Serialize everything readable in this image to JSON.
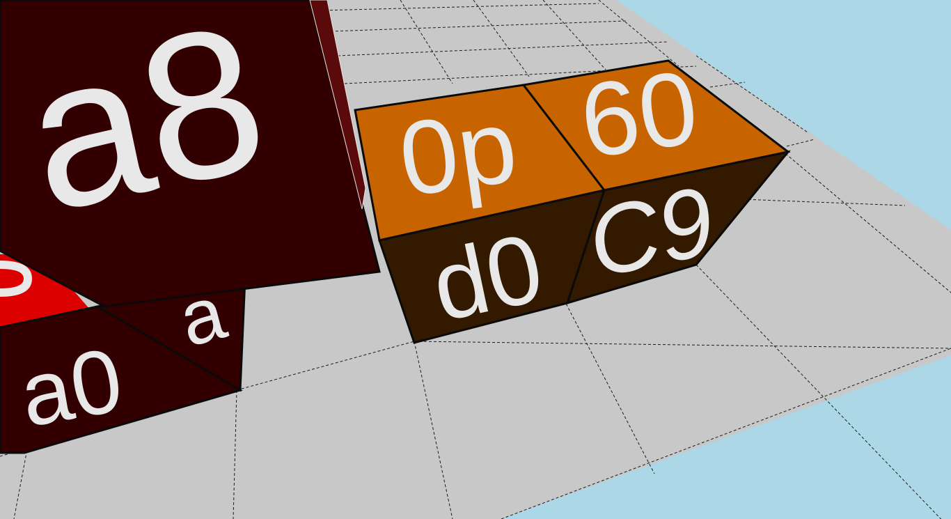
{
  "scene": {
    "sky_color": "#abd7e7",
    "floor_color": "#c8c8c8",
    "grid_line_color": "#1a1a1a",
    "edge_color": "#0a0a0a",
    "text_color": "#e8e8e8"
  },
  "blocks": [
    {
      "id": "dark-red-block",
      "color": "#320000",
      "top_label": "a8",
      "front_label": "a0",
      "side_label": "a"
    },
    {
      "id": "orange-block-left",
      "top_color": "#c86400",
      "front_color": "#321900",
      "top_label": "0p",
      "front_label": "d0"
    },
    {
      "id": "orange-block-right",
      "top_color": "#c86400",
      "front_color": "#321900",
      "top_label": "60",
      "front_label": "C9"
    }
  ],
  "accent": {
    "red_piece_color": "#dd0000"
  }
}
